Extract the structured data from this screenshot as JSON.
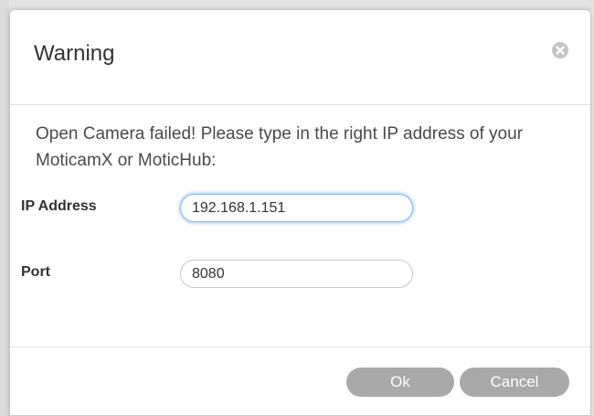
{
  "dialog": {
    "title": "Warning",
    "close_icon": "close-icon",
    "message": "Open Camera failed! Please type in the right IP address of your MoticamX or MoticHub:",
    "fields": {
      "ip": {
        "label": "IP Address",
        "value": "192.168.1.151"
      },
      "port": {
        "label": "Port",
        "value": "8080"
      }
    },
    "buttons": {
      "ok_label": "Ok",
      "cancel_label": "Cancel"
    }
  },
  "colors": {
    "button_bg": "#a9a9a9",
    "focus_glow": "#5296e1",
    "text": "#333333"
  }
}
